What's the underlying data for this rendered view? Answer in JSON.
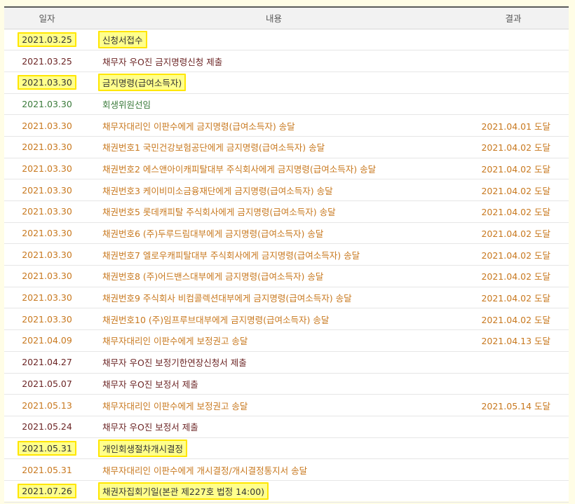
{
  "header": {
    "date": "일자",
    "content": "내용",
    "result": "결과"
  },
  "colors": {
    "maroon": "#6b2424",
    "orange": "#c8781e",
    "green": "#3a7a3a",
    "highlight_fill": "#ffff8c",
    "highlight_border": "#ffe600"
  },
  "rows": [
    {
      "date": "2021.03.25",
      "content": "신청서접수",
      "result": "",
      "color": "#333333",
      "highlight": true
    },
    {
      "date": "2021.03.25",
      "content": "채무자 우O진 금지명령신청 제출",
      "result": "",
      "color": "#6b2424",
      "highlight": false
    },
    {
      "date": "2021.03.30",
      "content": "금지명령(급여소득자)",
      "result": "",
      "color": "#333333",
      "highlight": true
    },
    {
      "date": "2021.03.30",
      "content": "회생위원선임",
      "result": "",
      "color": "#3a7a3a",
      "highlight": false
    },
    {
      "date": "2021.03.30",
      "content": "채무자대리인 이판수에게 금지명령(급여소득자) 송달",
      "result": "2021.04.01 도달",
      "color": "#c8781e",
      "highlight": false
    },
    {
      "date": "2021.03.30",
      "content": "채권번호1 국민건강보험공단에게 금지명령(급여소득자) 송달",
      "result": "2021.04.02 도달",
      "color": "#c8781e",
      "highlight": false
    },
    {
      "date": "2021.03.30",
      "content": "채권번호2 에스앤아이캐피탈대부 주식회사에게 금지명령(급여소득자) 송달",
      "result": "2021.04.02 도달",
      "color": "#c8781e",
      "highlight": false
    },
    {
      "date": "2021.03.30",
      "content": "채권번호3 케이비미소금융재단에게 금지명령(급여소득자) 송달",
      "result": "2021.04.02 도달",
      "color": "#c8781e",
      "highlight": false
    },
    {
      "date": "2021.03.30",
      "content": "채권번호5 롯데캐피탈 주식회사에게 금지명령(급여소득자) 송달",
      "result": "2021.04.02 도달",
      "color": "#c8781e",
      "highlight": false
    },
    {
      "date": "2021.03.30",
      "content": "채권번호6 (주)두루드림대부에게 금지명령(급여소득자) 송달",
      "result": "2021.04.02 도달",
      "color": "#c8781e",
      "highlight": false
    },
    {
      "date": "2021.03.30",
      "content": "채권번호7 엘로우캐피탈대부 주식회사에게 금지명령(급여소득자) 송달",
      "result": "2021.04.02 도달",
      "color": "#c8781e",
      "highlight": false
    },
    {
      "date": "2021.03.30",
      "content": "채권번호8 (주)어드밴스대부에게 금지명령(급여소득자) 송달",
      "result": "2021.04.02 도달",
      "color": "#c8781e",
      "highlight": false
    },
    {
      "date": "2021.03.30",
      "content": "채권번호9 주식회사 비컴콜렉션대부에게 금지명령(급여소득자) 송달",
      "result": "2021.04.02 도달",
      "color": "#c8781e",
      "highlight": false
    },
    {
      "date": "2021.03.30",
      "content": "채권번호10 (주)임프루브대부에게 금지명령(급여소득자) 송달",
      "result": "2021.04.02 도달",
      "color": "#c8781e",
      "highlight": false
    },
    {
      "date": "2021.04.09",
      "content": "채무자대리인 이판수에게 보정권고 송달",
      "result": "2021.04.13 도달",
      "color": "#c8781e",
      "highlight": false
    },
    {
      "date": "2021.04.27",
      "content": "채무자 우O진 보정기한연장신청서 제출",
      "result": "",
      "color": "#6b2424",
      "highlight": false
    },
    {
      "date": "2021.05.07",
      "content": "채무자 우O진 보정서 제출",
      "result": "",
      "color": "#6b2424",
      "highlight": false
    },
    {
      "date": "2021.05.13",
      "content": "채무자대리인 이판수에게 보정권고 송달",
      "result": "2021.05.14 도달",
      "color": "#c8781e",
      "highlight": false
    },
    {
      "date": "2021.05.24",
      "content": "채무자 우O진 보정서 제출",
      "result": "",
      "color": "#6b2424",
      "highlight": false
    },
    {
      "date": "2021.05.31",
      "content": "개인회생절차개시결정",
      "result": "",
      "color": "#333333",
      "highlight": true
    },
    {
      "date": "2021.05.31",
      "content": "채무자대리인 이판수에게 개시결정/개시결정통지서 송달",
      "result": "",
      "color": "#c8781e",
      "highlight": false
    },
    {
      "date": "2021.07.26",
      "content": "채권자집회기일(본관 제227호 법정 14:00)",
      "result": "",
      "color": "#333333",
      "highlight": true
    }
  ]
}
